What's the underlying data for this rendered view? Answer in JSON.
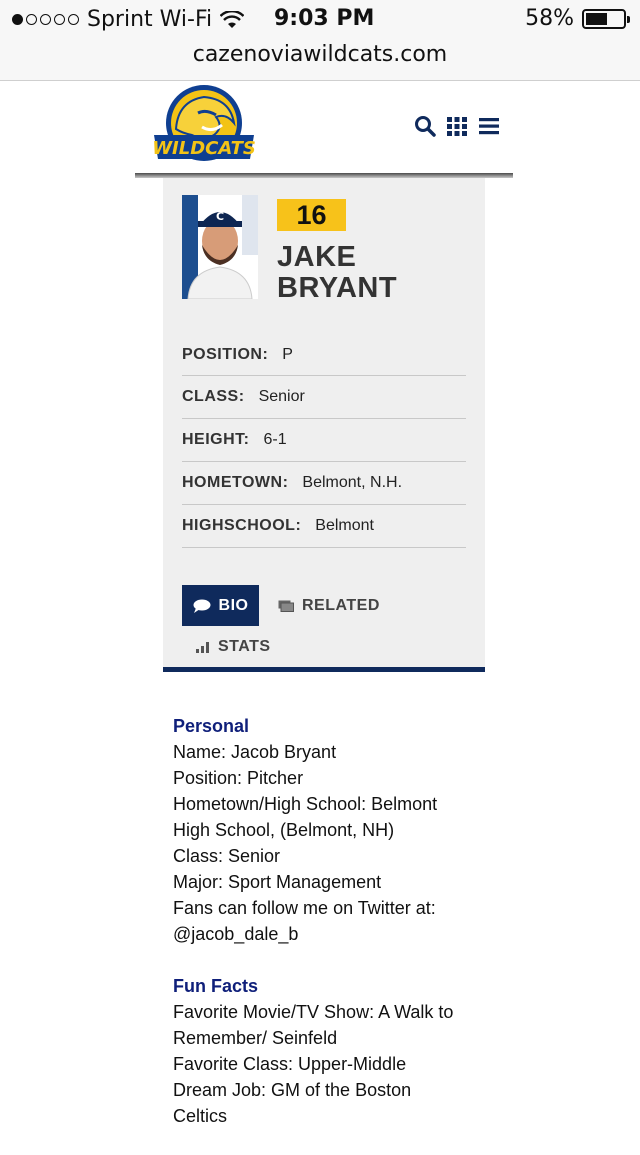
{
  "status_bar": {
    "carrier": "Sprint Wi-Fi",
    "signal_dots": 5,
    "signal_filled": 1,
    "time": "9:03 PM",
    "battery": "58%",
    "battery_level": 0.58
  },
  "browser": {
    "url": "cazenoviawildcats.com"
  },
  "header": {
    "logo_text_top": "CAZENOVIA COLLEGE",
    "logo_text": "WILDCATS",
    "icons": [
      "search-icon",
      "grid-icon",
      "menu-icon"
    ]
  },
  "player": {
    "number": "16",
    "first_name": "JAKE",
    "last_name": "BRYANT",
    "info": [
      {
        "label": "POSITION:",
        "value": "P"
      },
      {
        "label": "CLASS:",
        "value": "Senior"
      },
      {
        "label": "HEIGHT:",
        "value": "6-1"
      },
      {
        "label": "HOMETOWN:",
        "value": "Belmont, N.H."
      },
      {
        "label": "HIGHSCHOOL:",
        "value": "Belmont"
      }
    ]
  },
  "tabs": {
    "bio": "BIO",
    "related": "RELATED",
    "stats": "STATS"
  },
  "bio": {
    "personal": {
      "heading": "Personal",
      "lines": [
        "Name: Jacob Bryant",
        "Position: Pitcher",
        "Hometown/High School: Belmont",
        "High School, (Belmont, NH)",
        "Class: Senior",
        "Major: Sport Management",
        "Fans can follow me on Twitter at:",
        "@jacob_dale_b"
      ]
    },
    "fun_facts": {
      "heading": "Fun Facts",
      "lines": [
        "Favorite Movie/TV Show: A Walk to",
        "Remember/ Seinfeld",
        "Favorite Class: Upper-Middle",
        "Dream Job: GM of the Boston",
        "Celtics"
      ]
    }
  },
  "colors": {
    "navy": "#0f2a5c",
    "gold": "#f7c21a",
    "heading_blue": "#0f1f7a",
    "card_bg": "#efefef"
  }
}
